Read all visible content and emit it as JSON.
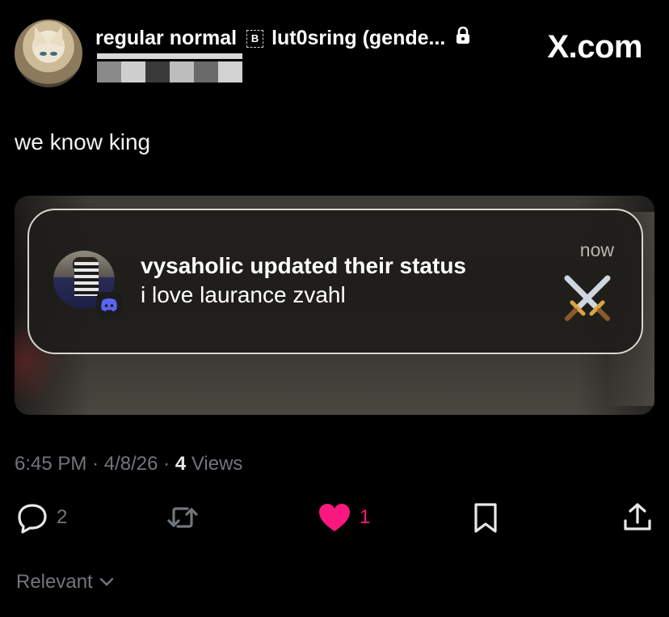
{
  "header": {
    "display_name": "regular normal",
    "badge_letter": "B",
    "handle": "lut0sring (gende...",
    "site": "X.com"
  },
  "tweet": {
    "text": "we know king"
  },
  "notification": {
    "title": "vysaholic updated their status",
    "body": "i love laurance zvahl",
    "time": "now",
    "icons": {
      "badge": "discord-icon",
      "emoji": "crossed-swords-icon"
    }
  },
  "meta": {
    "time": "6:45 PM",
    "separator": "·",
    "date": "4/8/26",
    "views_count": "4",
    "views_label": "Views"
  },
  "actions": {
    "reply_count": "2",
    "like_count": "1"
  },
  "footer": {
    "sort_label": "Relevant"
  },
  "colors": {
    "background": "#000000",
    "like": "#f91880",
    "muted": "#71767b"
  }
}
